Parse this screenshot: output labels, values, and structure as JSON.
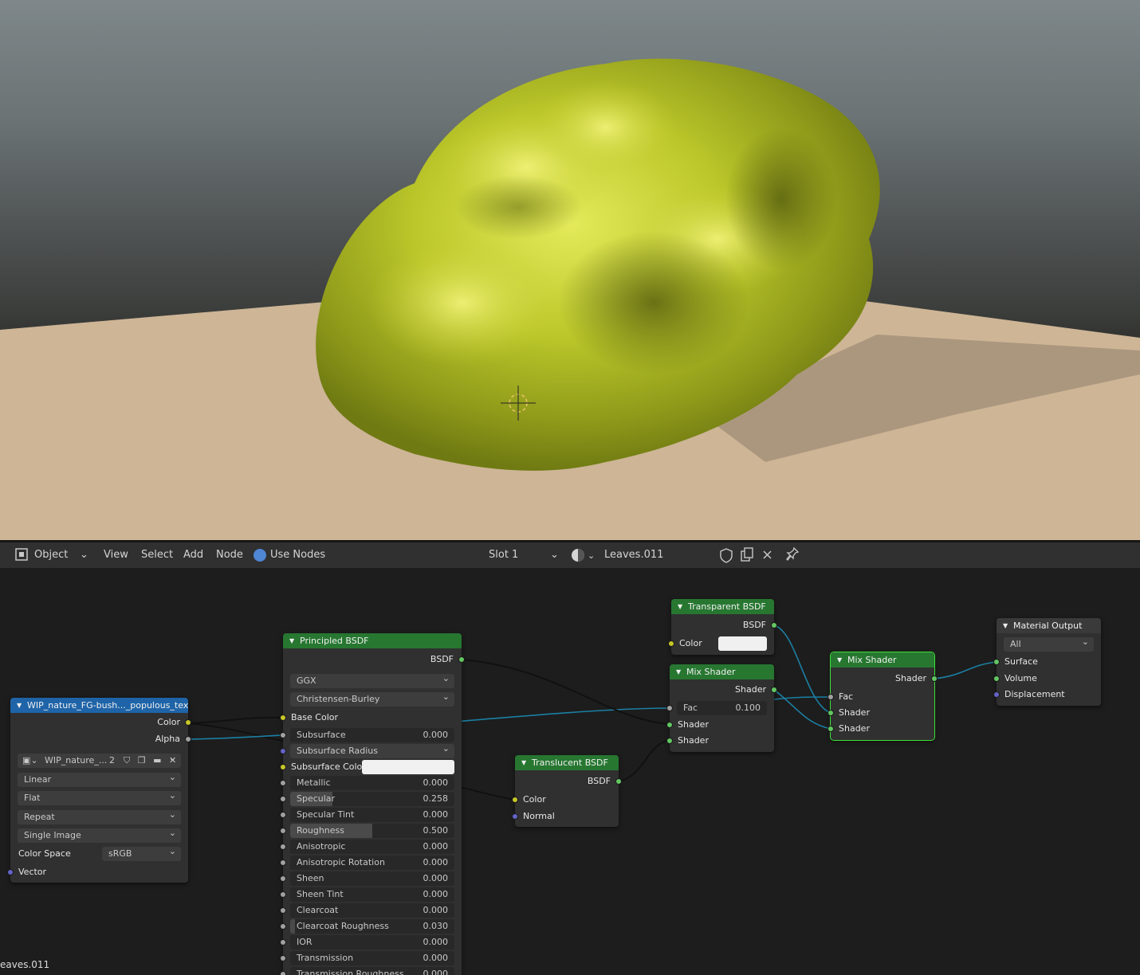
{
  "header": {
    "mode": "Object",
    "menus": [
      "View",
      "Select",
      "Add",
      "Node"
    ],
    "use_nodes": "Use Nodes",
    "slot": "Slot 1",
    "material": "Leaves.011"
  },
  "nodes": {
    "texture": {
      "title": "WIP_nature_FG-bush..._populous_texture.p",
      "out_color": "Color",
      "out_alpha": "Alpha",
      "image_name": "WIP_nature_...",
      "users": "2",
      "interpolation": "Linear",
      "projection": "Flat",
      "extension": "Repeat",
      "source": "Single Image",
      "colorspace_label": "Color Space",
      "colorspace_value": "sRGB",
      "in_vector": "Vector"
    },
    "principled": {
      "title": "Principled BSDF",
      "out": "BSDF",
      "distribution": "GGX",
      "subsurface_method": "Christensen-Burley",
      "base_color": "Base Color",
      "subsurface_color": "Subsurface Colo",
      "subsurface_radius": "Subsurface Radius",
      "fields": [
        {
          "label": "Subsurface",
          "value": "0.000",
          "fill": 0
        },
        {
          "label": "Metallic",
          "value": "0.000",
          "fill": 0
        },
        {
          "label": "Specular",
          "value": "0.258",
          "fill": 0.258
        },
        {
          "label": "Specular Tint",
          "value": "0.000",
          "fill": 0
        },
        {
          "label": "Roughness",
          "value": "0.500",
          "fill": 0.5
        },
        {
          "label": "Anisotropic",
          "value": "0.000",
          "fill": 0
        },
        {
          "label": "Anisotropic Rotation",
          "value": "0.000",
          "fill": 0
        },
        {
          "label": "Sheen",
          "value": "0.000",
          "fill": 0
        },
        {
          "label": "Sheen Tint",
          "value": "0.000",
          "fill": 0
        },
        {
          "label": "Clearcoat",
          "value": "0.000",
          "fill": 0
        },
        {
          "label": "Clearcoat Roughness",
          "value": "0.030",
          "fill": 0.03
        },
        {
          "label": "IOR",
          "value": "0.000",
          "fill": 0
        },
        {
          "label": "Transmission",
          "value": "0.000",
          "fill": 0
        },
        {
          "label": "Transmission Roughness",
          "value": "0.000",
          "fill": 0
        }
      ]
    },
    "translucent": {
      "title": "Translucent BSDF",
      "out": "BSDF",
      "in_color": "Color",
      "in_normal": "Normal"
    },
    "transparent": {
      "title": "Transparent BSDF",
      "out": "BSDF",
      "in_color": "Color"
    },
    "mix1": {
      "title": "Mix Shader",
      "out": "Shader",
      "fac_label": "Fac",
      "fac_value": "0.100",
      "in1": "Shader",
      "in2": "Shader"
    },
    "mix2": {
      "title": "Mix Shader",
      "out": "Shader",
      "fac": "Fac",
      "in1": "Shader",
      "in2": "Shader"
    },
    "output": {
      "title": "Material Output",
      "target": "All",
      "surface": "Surface",
      "volume": "Volume",
      "displacement": "Displacement"
    }
  },
  "corner_label": "eaves.011"
}
